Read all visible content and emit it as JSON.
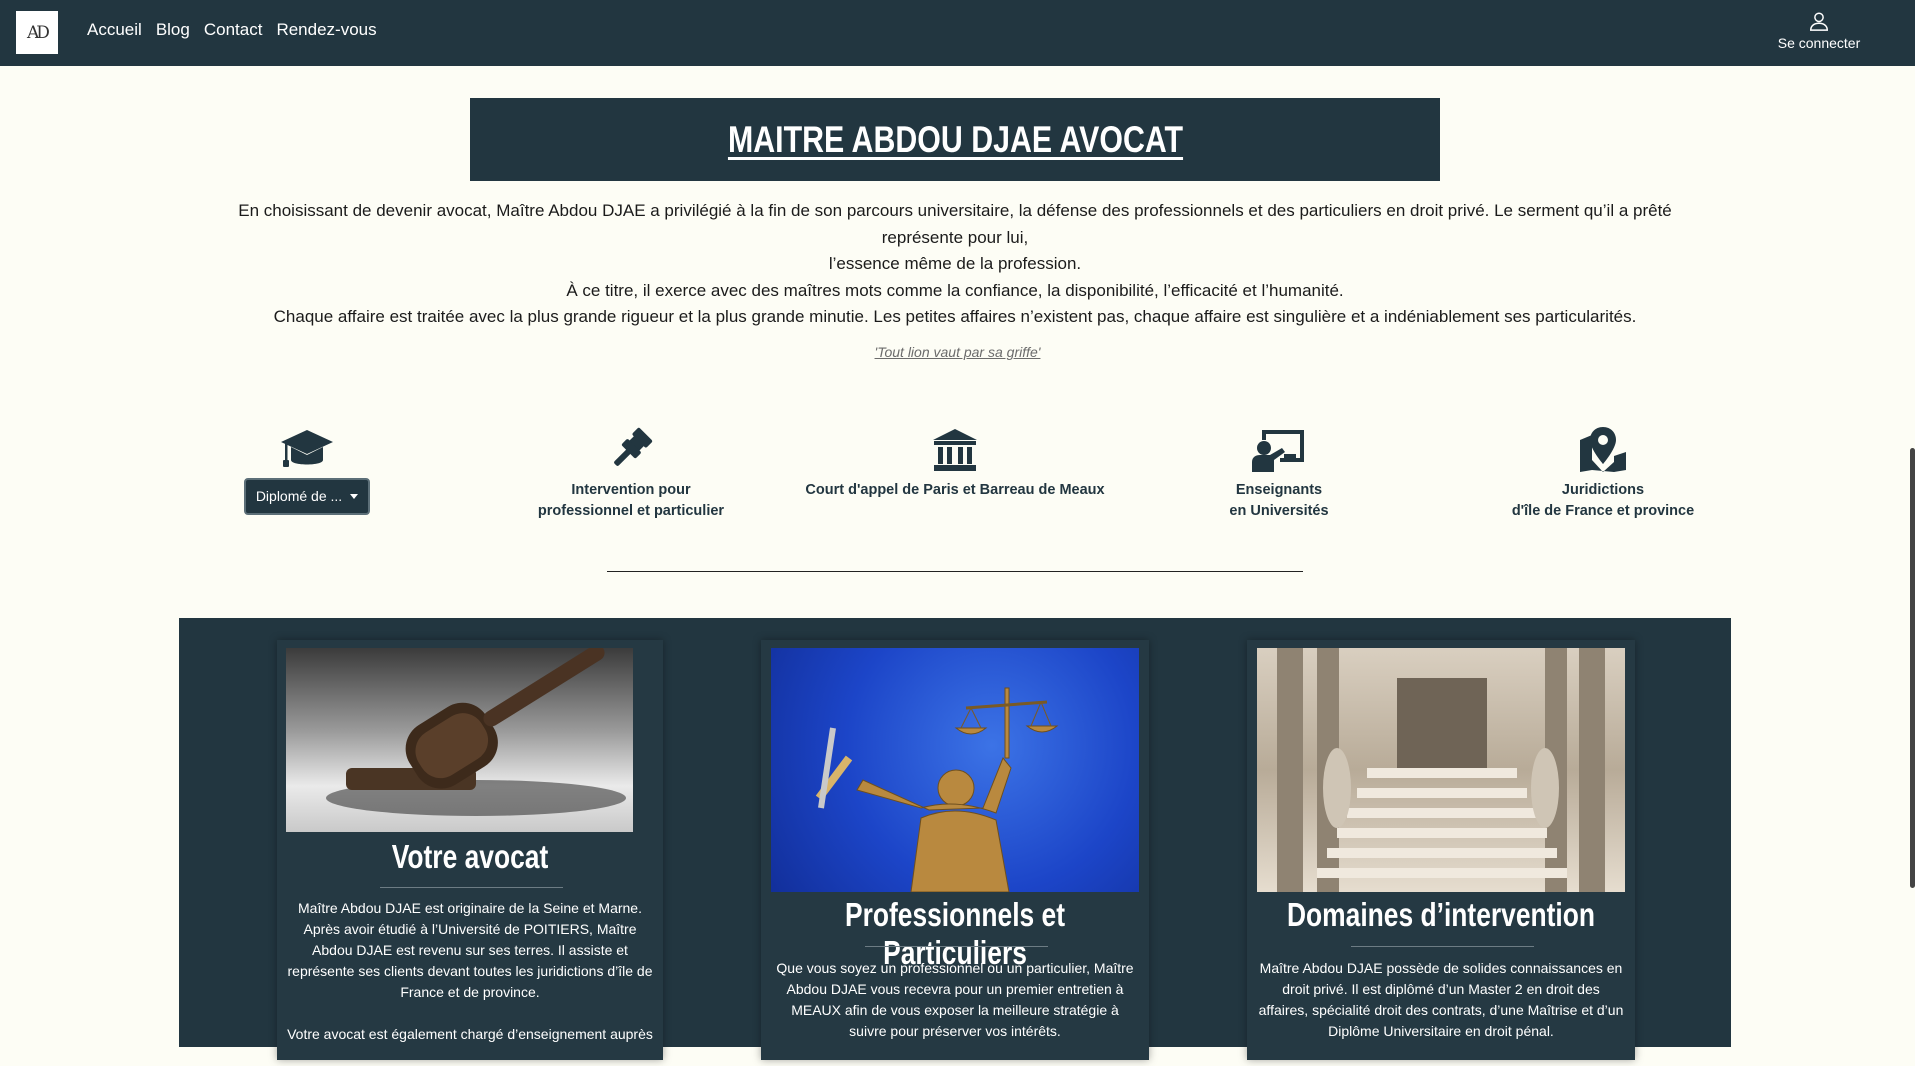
{
  "nav": {
    "logo": "AD",
    "links": [
      "Accueil",
      "Blog",
      "Contact",
      "Rendez-vous"
    ],
    "login_label": "Se connecter"
  },
  "header": {
    "title": "MAITRE ABDOU DJAE AVOCAT",
    "intro": [
      "En choisissant de devenir avocat, Maître Abdou DJAE a privilégié à la fin de son parcours universitaire, la défense des professionnels et des particuliers en droit privé. Le serment qu’il a prêté représente pour lui,",
      "l’essence même de la profession.",
      "À ce titre, il exerce avec des maîtres mots comme la confiance, la disponibilité, l’efficacité et l’humanité.",
      "Chaque affaire est traitée avec la plus grande rigueur et la plus grande minutie. Les petites affaires n’existent pas, chaque affaire est singulière et a indéniablement ses particularités."
    ],
    "motto": "'Tout lion vaut par sa griffe'"
  },
  "features": [
    {
      "icon": "graduation-cap-icon",
      "dropdown_label": "Diplomé de ..."
    },
    {
      "icon": "gavel-icon",
      "line1": "Intervention pour",
      "line2": "professionnel et particulier"
    },
    {
      "icon": "courthouse-icon",
      "line1": "Court d'appel de Paris et Barreau de Meaux"
    },
    {
      "icon": "teacher-board-icon",
      "line1": "Enseignants",
      "line2": "en Universités"
    },
    {
      "icon": "map-marker-icon",
      "line1": "Juridictions",
      "line2": "d'île de France et province"
    }
  ],
  "cards": [
    {
      "title": "Votre avocat",
      "paragraphs": [
        "Maître Abdou DJAE est originaire de la Seine et Marne. Après avoir étudié à l’Université de POITIERS, Maître Abdou DJAE est revenu sur ses terres. Il assiste et représente ses clients devant toutes les juridictions d’île de France et de province.",
        "Votre avocat est également chargé d’enseignement auprès"
      ]
    },
    {
      "title": "Professionnels et Particuliers",
      "paragraphs": [
        "Que vous soyez un professionnel ou un particulier, Maître Abdou DJAE vous recevra pour un premier entretien à MEAUX afin de vous exposer la meilleure stratégie à suivre pour préserver vos intérêts."
      ]
    },
    {
      "title": "Domaines d’intervention",
      "paragraphs": [
        "Maître Abdou DJAE possède de solides connaissances en droit privé. Il est diplômé d’un Master 2 en droit des affaires, spécialité droit des contrats, d’une Maîtrise et d’un Diplôme Universitaire en droit pénal."
      ]
    }
  ]
}
